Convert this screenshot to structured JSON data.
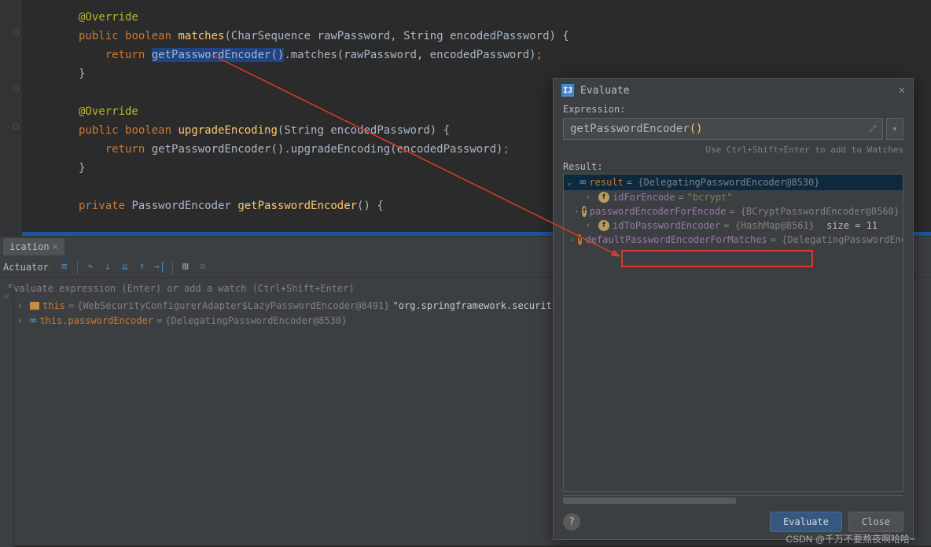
{
  "code": {
    "ann_override1": "@Override",
    "ann_override2": "@Override",
    "kw_public": "public",
    "kw_boolean": "boolean",
    "kw_return": "return",
    "kw_private": "private",
    "m_matches": "matches",
    "m_upgrade": "upgradeEncoding",
    "m_getEnc": "getPasswordEncoder",
    "t_CharSeq": "CharSequence",
    "t_String": "String",
    "t_PasswordEncoder": "PasswordEncoder",
    "p_rawPassword": "rawPassword",
    "p_encodedPassword": "encodedPassword",
    "call_matches": ".matches(rawPassword, encodedPassword)",
    "call_upgrade": ".upgradeEncoding(encodedPassword)"
  },
  "panel": {
    "tab": "ication",
    "actuator": "Actuator",
    "hint": "Evaluate expression (Enter) or add a watch (Ctrl+Shift+Enter)",
    "var_this_name": "this",
    "var_this_val": "{WebSecurityConfigurerAdapter$LazyPasswordEncoder@8491}",
    "var_this_bold": "\"org.springframework.security.crypto.pa",
    "var_pe_name": "this.passwordEncoder",
    "var_pe_val": "{DelegatingPasswordEncoder@8530}"
  },
  "eval": {
    "title": "Evaluate",
    "expr_label": "Expression:",
    "expr_value_a": "getPasswordEncoder",
    "expr_value_b": "()",
    "hint": "Use Ctrl+Shift+Enter to add to Watches",
    "result_label": "Result:",
    "tree": {
      "root_name": "result",
      "root_val": "= {DelegatingPasswordEncoder@8530}",
      "f1_name": "idForEncode",
      "f1_val": "\"bcrypt\"",
      "f2_name": "passwordEncoderForEncode",
      "f2_val": "= {BCryptPasswordEncoder@8560}",
      "f3_name": "idToPasswordEncoder",
      "f3_val": "= {HashMap@8561}",
      "f3_size": "size = 11",
      "f4_name": "defaultPasswordEncoderForMatches",
      "f4_val": "= {DelegatingPasswordEncod"
    },
    "btn_eval": "Evaluate",
    "btn_close": "Close"
  },
  "watermark": "CSDN @千万不要熬夜啊哈哈~"
}
